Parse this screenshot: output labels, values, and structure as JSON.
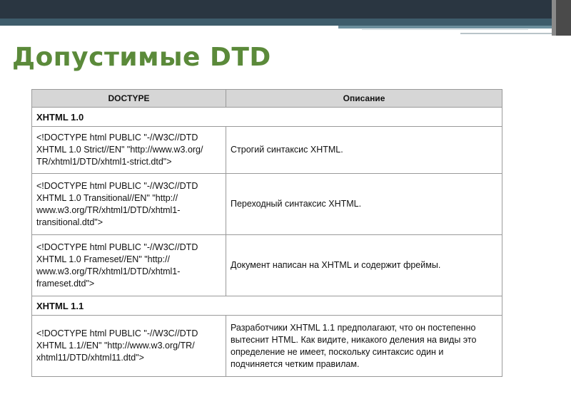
{
  "title": "Допустимые DTD",
  "table": {
    "headers": [
      "DOCTYPE",
      "Описание"
    ],
    "sections": [
      {
        "name": "XHTML 1.0",
        "rows": [
          {
            "doctype": [
              "<!DOCTYPE html PUBLIC \"-//W3C//DTD",
              "XHTML 1.0 Strict//EN\" \"http://www.w3.org/",
              "TR/xhtml1/DTD/xhtml1-strict.dtd\">"
            ],
            "desc": [
              "Строгий синтаксис XHTML."
            ]
          },
          {
            "doctype": [
              "<!DOCTYPE html PUBLIC \"-//W3C//DTD",
              "XHTML 1.0 Transitional//EN\" \"http://",
              "www.w3.org/TR/xhtml1/DTD/xhtml1-",
              "transitional.dtd\">"
            ],
            "desc": [
              "Переходный синтаксис XHTML."
            ]
          },
          {
            "doctype": [
              "<!DOCTYPE html PUBLIC \"-//W3C//DTD",
              "XHTML 1.0 Frameset//EN\" \"http://",
              "www.w3.org/TR/xhtml1/DTD/xhtml1-",
              "frameset.dtd\">"
            ],
            "desc": [
              "Документ написан на XHTML и содержит фреймы."
            ]
          }
        ]
      },
      {
        "name": "XHTML 1.1",
        "rows": [
          {
            "doctype": [
              "<!DOCTYPE html PUBLIC \"-//W3C//DTD",
              "XHTML 1.1//EN\" \"http://www.w3.org/TR/",
              "xhtml11/DTD/xhtml11.dtd\">"
            ],
            "desc": [
              "Разработчики XHTML 1.1 предполагают, что он постепенно",
              "вытеснит HTML. Как видите, никакого деления на виды это",
              "определение не имеет, поскольку синтаксис один и",
              "подчиняется четким правилам."
            ]
          }
        ]
      }
    ]
  }
}
